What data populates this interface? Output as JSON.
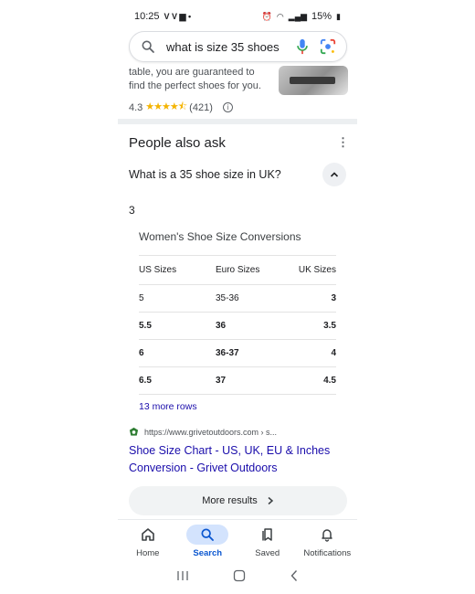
{
  "status_bar": {
    "time": "10:25",
    "battery": "15%"
  },
  "search": {
    "query": "what is size 35 shoes"
  },
  "snippet": {
    "text": "table, you are guaranteed to find the perfect shoes for you.",
    "rating": "4.3",
    "stars": "★★★★⯪",
    "reviews": "(421)"
  },
  "people_also_ask": {
    "title": "People also ask",
    "question": "What is a 35 shoe size in UK?",
    "answer": "3",
    "table": {
      "title": "Women's Shoe Size Conversions",
      "headers": [
        "US Sizes",
        "Euro Sizes",
        "UK Sizes"
      ],
      "rows": [
        [
          "5",
          "35-36",
          "3"
        ],
        [
          "5.5",
          "36",
          "3.5"
        ],
        [
          "6",
          "36-37",
          "4"
        ],
        [
          "6.5",
          "37",
          "4.5"
        ]
      ]
    },
    "more_rows": "13 more rows",
    "source_url": "https://www.grivetoutdoors.com › s...",
    "result_title": "Shoe Size Chart - US, UK, EU & Inches Conversion - Grivet Outdoors"
  },
  "more_results": "More results",
  "bottom_nav": [
    {
      "label": "Home",
      "icon": "home-icon"
    },
    {
      "label": "Search",
      "icon": "search-icon",
      "active": true
    },
    {
      "label": "Saved",
      "icon": "saved-icon"
    },
    {
      "label": "Notifications",
      "icon": "bell-icon"
    }
  ],
  "colors": {
    "link": "#1a0dab",
    "active_nav": "#0b57d0",
    "active_nav_bg": "#d3e3fd",
    "star": "#f4b400"
  }
}
